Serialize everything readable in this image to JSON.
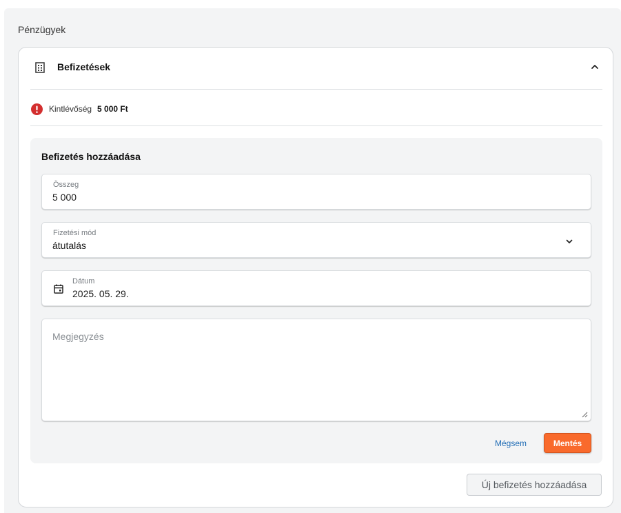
{
  "section": {
    "title": "Pénzügyek"
  },
  "card": {
    "title": "Befizetések",
    "icon": "building-icon",
    "collapse_icon": "chevron-up-icon"
  },
  "balance": {
    "icon": "alert-circle-icon",
    "label": "Kintlévőség",
    "value": "5 000 Ft",
    "icon_color": "#d32f2f"
  },
  "form": {
    "title": "Befizetés hozzáadása",
    "amount": {
      "label": "Összeg",
      "value": "5 000"
    },
    "payment_method": {
      "label": "Fizetési mód",
      "value": "átutalás",
      "icon": "chevron-down-icon"
    },
    "date": {
      "label": "Dátum",
      "value": "2025. 05. 29.",
      "icon": "calendar-icon"
    },
    "note": {
      "placeholder": "Megjegyzés"
    },
    "cancel_label": "Mégsem",
    "save_label": "Mentés"
  },
  "add_payment_label": "Új befizetés hozzáadása",
  "colors": {
    "accent": "#f96a2c",
    "link": "#1f6cb5",
    "error": "#d32f2f"
  }
}
